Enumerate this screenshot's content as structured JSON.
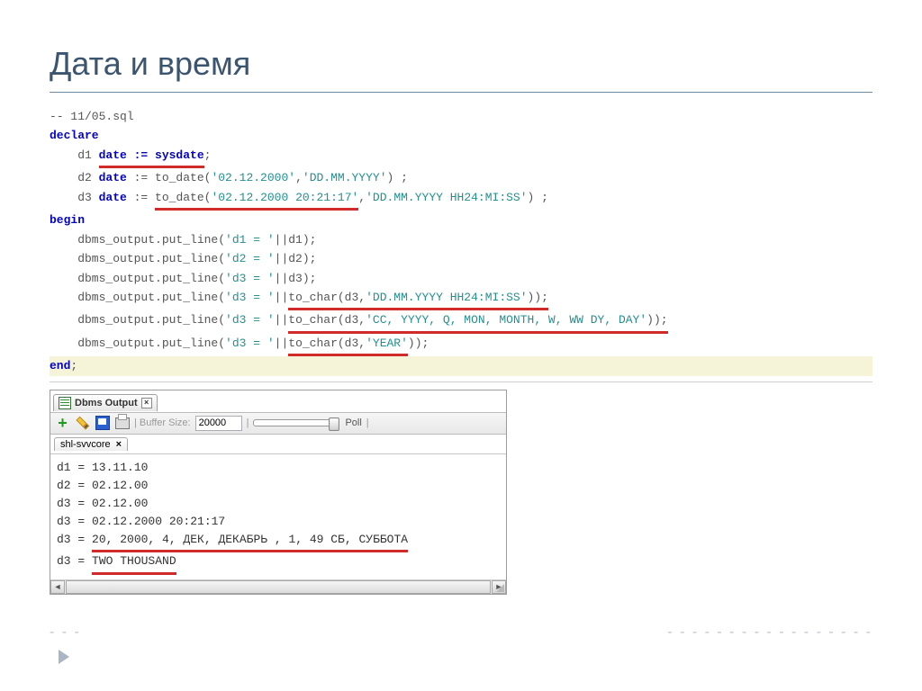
{
  "title": "Дата и время",
  "code": {
    "c0": "-- 11/05.sql",
    "kw_declare": "declare",
    "l1_a": "    d1 ",
    "l1_u": "date := sysdate",
    "l1_b": ";",
    "l2_a": "    d2 ",
    "l2_kw": "date",
    "l2_b": " := to_date(",
    "l2_s1": "'02.12.2000'",
    "l2_c": ",",
    "l2_s2": "'DD.MM.YYYY'",
    "l2_d": ") ;",
    "l3_a": "    d3 ",
    "l3_kw": "date",
    "l3_b": " := ",
    "l3_u": "to_date(",
    "l3_s1": "'02.12.2000 20:21:17'",
    "l3_c": ",",
    "l3_s2": "'DD.MM.YYYY HH24:MI:SS'",
    "l3_d": ") ;",
    "kw_begin": "begin",
    "p1": "    dbms_output.put_line(",
    "p1s": "'d1 = '",
    "p1b": "||d1);",
    "p2": "    dbms_output.put_line(",
    "p2s": "'d2 = '",
    "p2b": "||d2);",
    "p3": "    dbms_output.put_line(",
    "p3s": "'d3 = '",
    "p3b": "||d3);",
    "p4": "    dbms_output.put_line(",
    "p4s": "'d3 = '",
    "p4b": "||",
    "p4u": "to_char(d3,",
    "p4s2": "'DD.MM.YYYY HH24:MI:SS'",
    "p4c": "));",
    "p5": "    dbms_output.put_line(",
    "p5s": "'d3 = '",
    "p5b": "||",
    "p5u": "to_char(d3,",
    "p5s2": "'CC, YYYY, Q, MON, MONTH, W, WW DY, DAY'",
    "p5c": "));",
    "p6": "    dbms_output.put_line(",
    "p6s": "'d3 = '",
    "p6b": "||",
    "p6u": "to_char(d3,",
    "p6s2": "'YEAR'",
    "p6c": "));",
    "kw_end": "end",
    "end_semi": ";"
  },
  "panel": {
    "tab_title": "Dbms Output",
    "buffer_label": "| Buffer Size:",
    "buffer_value": "20000",
    "poll_label": "Poll",
    "subtab": "shl-svvcore",
    "out1": "d1 = 13.11.10",
    "out2": "d2 = 02.12.00",
    "out3": "d3 = 02.12.00",
    "out4": "d3 = 02.12.2000 20:21:17",
    "out5_a": "d3 = ",
    "out5_u": "20, 2000, 4, ДЕК, ДЕКАБРЬ , 1, 49 СБ, СУББОТА",
    "out6_a": "d3 = ",
    "out6_u": "TWO THOUSAND"
  },
  "dashes": {
    "left": "- - -",
    "right": "- - - - - - - - - - - - - - - - -"
  }
}
